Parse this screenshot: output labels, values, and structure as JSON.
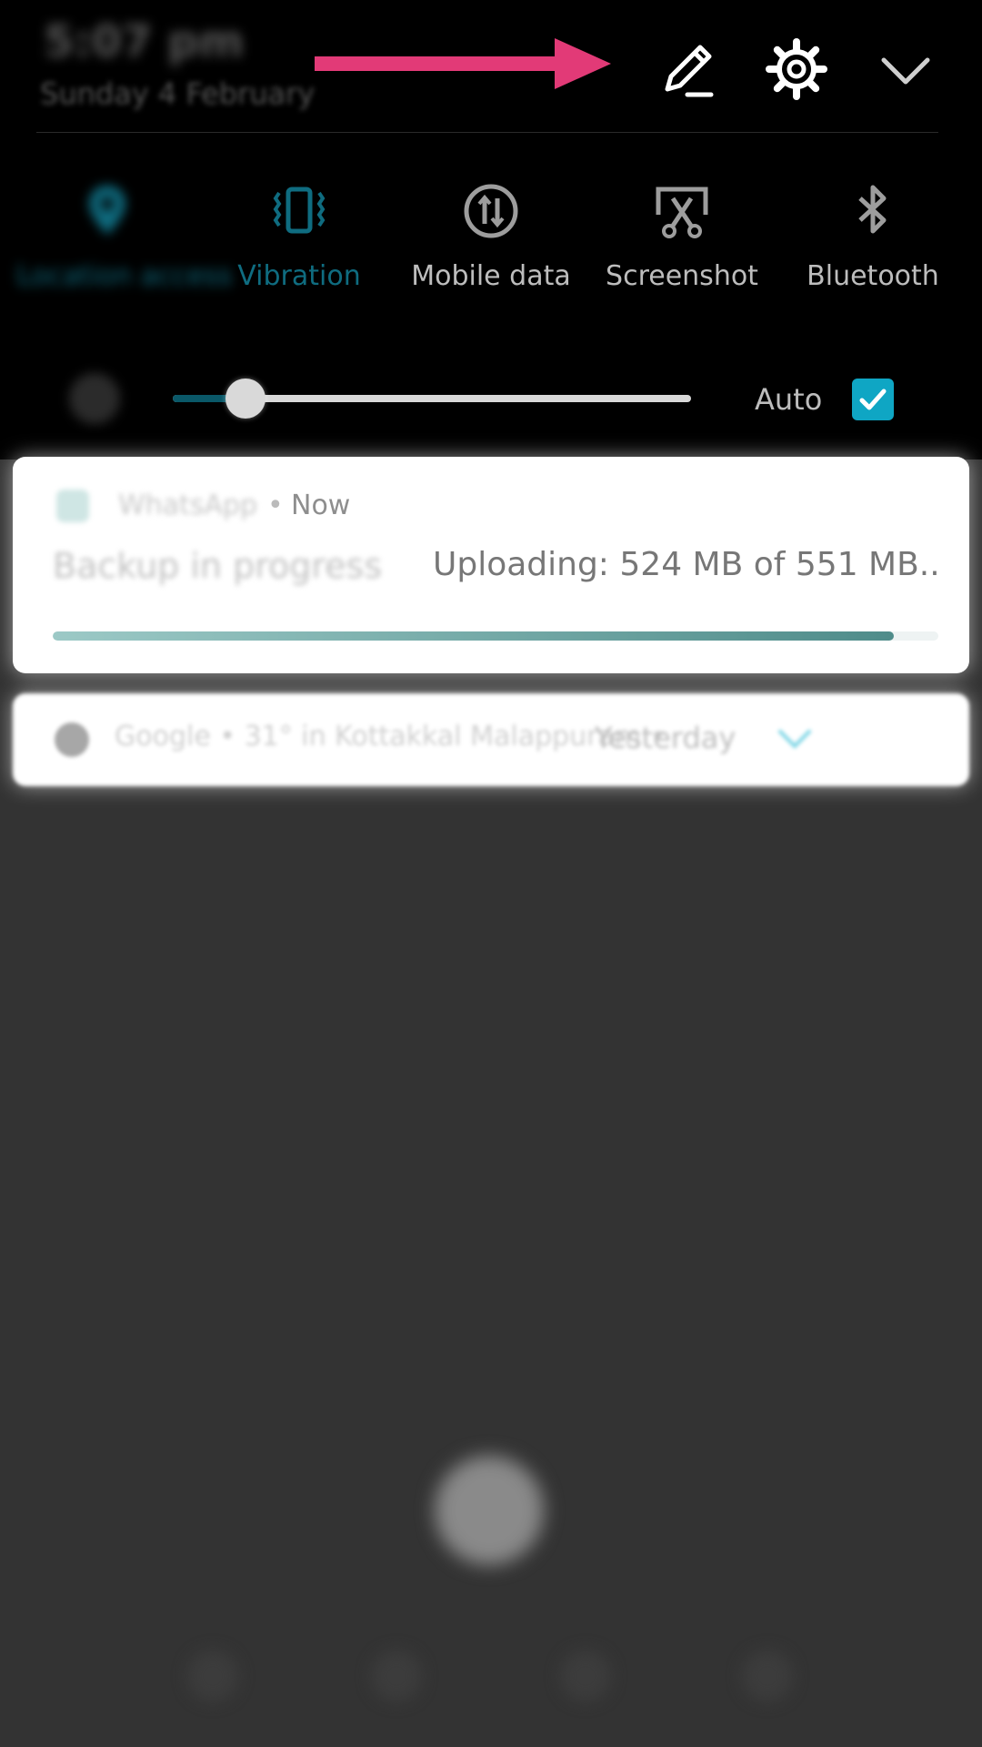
{
  "header": {
    "time": "5:07 pm",
    "date": "Sunday 4 February",
    "arrow_color": "#E23A77",
    "edit_icon": "pencil-icon",
    "settings_icon": "gear-icon",
    "collapse_icon": "chevron-down-icon"
  },
  "toggles": [
    {
      "label": "Location access",
      "icon": "location-icon",
      "active": true
    },
    {
      "label": "Vibration",
      "icon": "vibration-icon",
      "active": true
    },
    {
      "label": "Mobile data",
      "icon": "mobile-data-icon",
      "active": false
    },
    {
      "label": "Screenshot",
      "icon": "screenshot-icon",
      "active": false
    },
    {
      "label": "Bluetooth",
      "icon": "bluetooth-icon",
      "active": false
    }
  ],
  "brightness": {
    "level": 0.14,
    "auto_label": "Auto",
    "auto_checked": true
  },
  "notifications": {
    "backup": {
      "app": "WhatsApp",
      "separator": "•",
      "time": "Now",
      "title": "Backup in progress",
      "body": "Uploading: 524 MB of 551 MB..",
      "progress": 0.95
    },
    "google": {
      "app": "Google",
      "text": "• 31° in Kottakkal Malappuram •",
      "time": "Yesterday"
    }
  },
  "colors": {
    "accent": "#0FA6C4",
    "active_tile": "#0F6C80",
    "panel_bg": "#000000",
    "backdrop": "#333333"
  }
}
